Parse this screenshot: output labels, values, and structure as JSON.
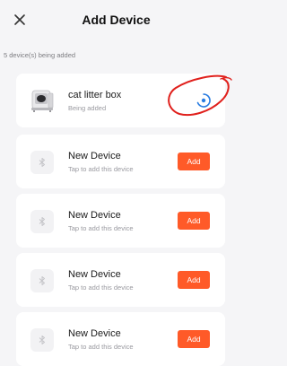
{
  "header": {
    "title": "Add Device",
    "close_icon": "close-icon"
  },
  "status_text": "5 device(s) being added",
  "devices": [
    {
      "name": "cat litter box",
      "status": "Being added",
      "icon": "litter-box-image",
      "state": "adding"
    },
    {
      "name": "New Device",
      "status": "Tap to add this device",
      "icon": "bluetooth-icon",
      "action_label": "Add"
    },
    {
      "name": "New Device",
      "status": "Tap to add this device",
      "icon": "bluetooth-icon",
      "action_label": "Add"
    },
    {
      "name": "New Device",
      "status": "Tap to add this device",
      "icon": "bluetooth-icon",
      "action_label": "Add"
    },
    {
      "name": "New Device",
      "status": "Tap to add this device",
      "icon": "bluetooth-icon",
      "action_label": "Add"
    }
  ],
  "colors": {
    "accent": "#ff5a28",
    "spinner": "#2a7de1",
    "annotation": "#e0201c",
    "background": "#f5f5f7"
  }
}
